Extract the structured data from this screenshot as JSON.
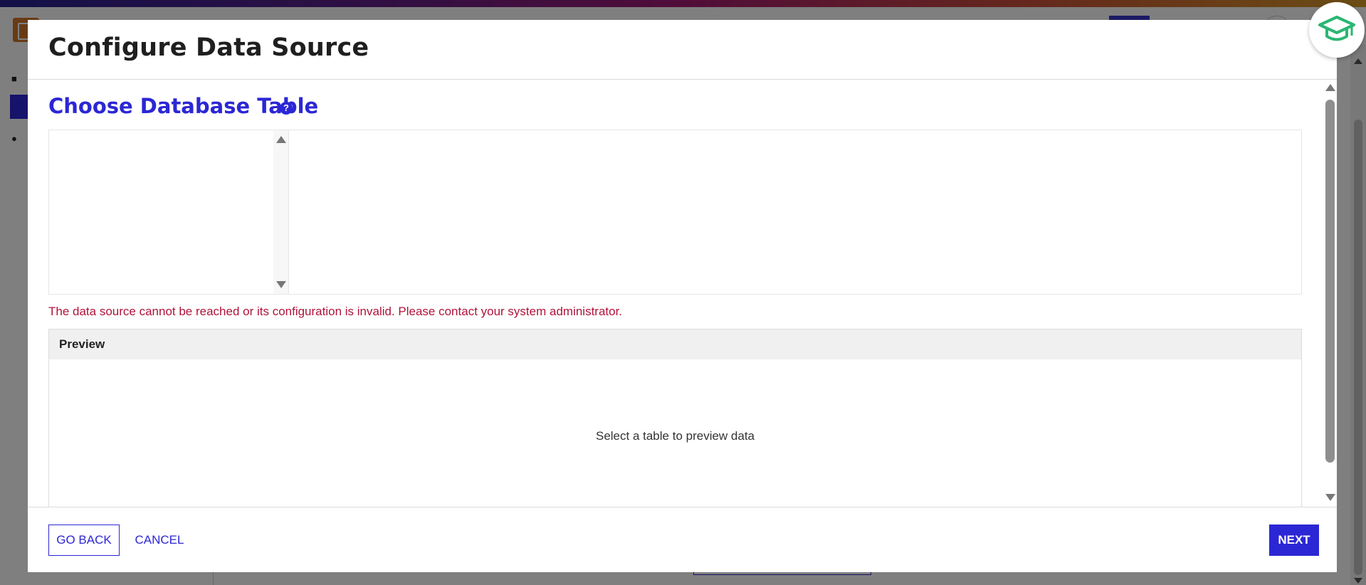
{
  "modal": {
    "title": "Configure Data Source",
    "section_title": "Choose Database Table",
    "help_icon": "question-circle-icon",
    "error_message": "The data source cannot be reached or its configuration is invalid. Please contact your system administrator.",
    "preview": {
      "title": "Preview",
      "empty_text": "Select a table to preview data"
    },
    "footer": {
      "go_back_label": "GO BACK",
      "cancel_label": "CANCEL",
      "next_label": "NEXT"
    }
  },
  "floating_badge": {
    "icon": "graduation-cap-icon"
  },
  "colors": {
    "accent": "#2c27d4",
    "error": "#b0133a",
    "badge_green": "#2bb673"
  }
}
